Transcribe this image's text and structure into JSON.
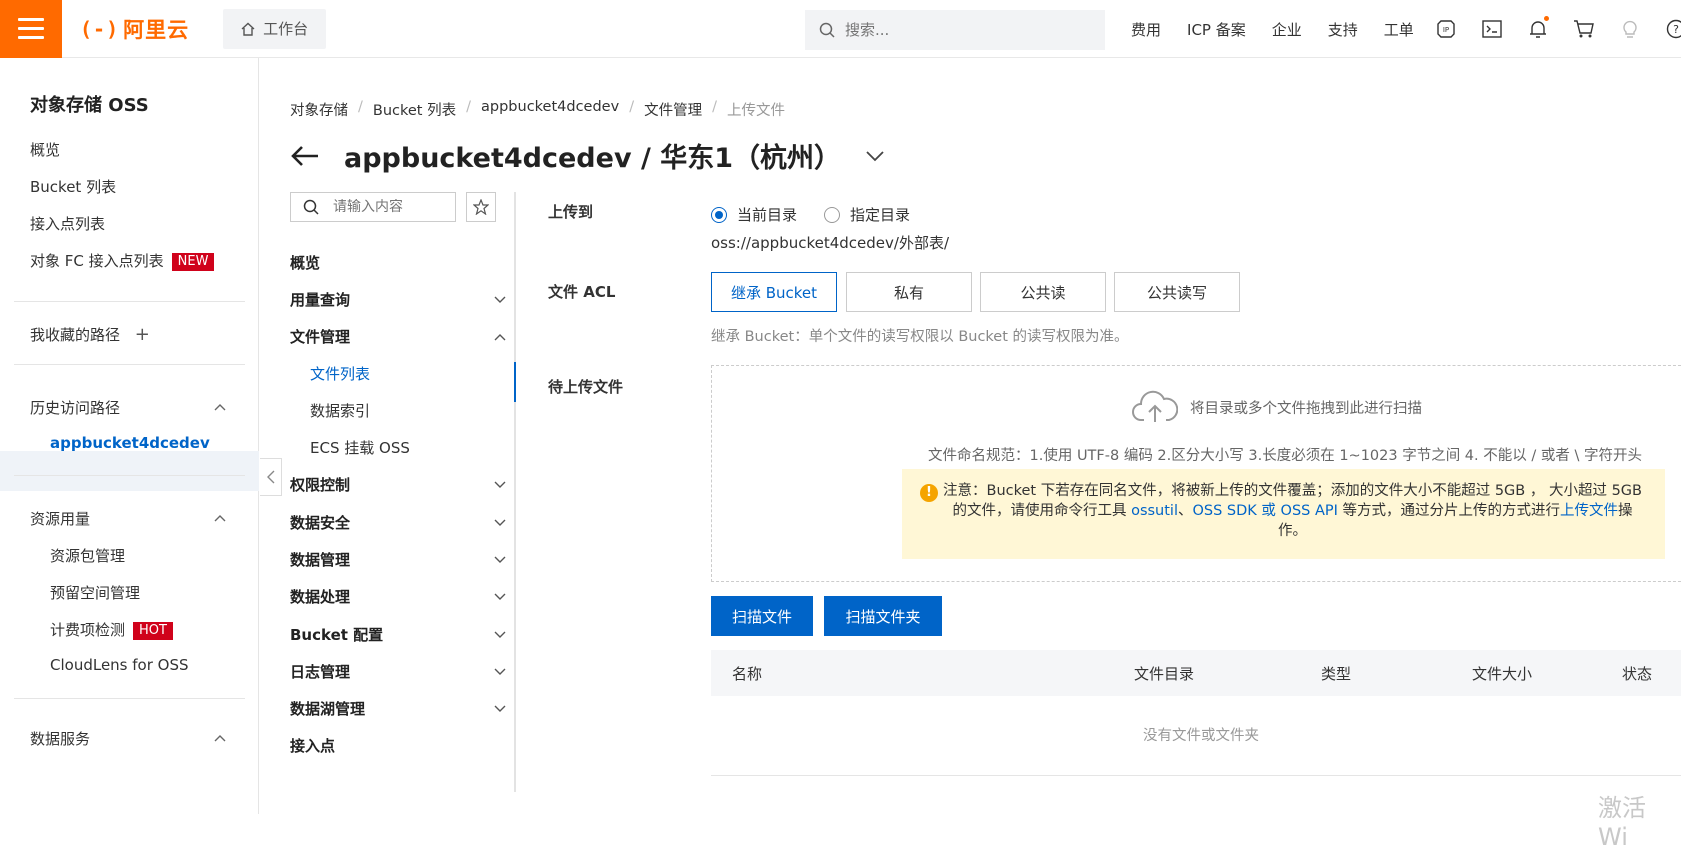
{
  "topbar": {
    "logo_text": "阿里云",
    "logo_mark": "(-)",
    "workbench": "工作台",
    "search_placeholder": "搜索...",
    "nav": [
      "费用",
      "ICP 备案",
      "企业",
      "支持",
      "工单"
    ],
    "icons": [
      "ipv6-icon",
      "terminal-icon",
      "bell-icon",
      "cart-icon",
      "bulb-icon",
      "help-icon"
    ],
    "accent": "#ff6a00"
  },
  "sidebar": {
    "title": "对象存储 OSS",
    "items": {
      "overview": "概览",
      "bucket_list": "Bucket 列表",
      "access_points": "接入点列表",
      "fc_access_points": "对象 FC 接入点列表",
      "new_badge": "NEW",
      "favorites": "我收藏的路径",
      "history": "历史访问路径",
      "history_bucket": "appbucket4dcedev",
      "resource_usage": "资源用量",
      "resource_pkg": "资源包管理",
      "reserved_space": "预留空间管理",
      "billing_check": "计费项检测",
      "hot_badge": "HOT",
      "cloudlens": "CloudLens for OSS",
      "data_services": "数据服务"
    }
  },
  "breadcrumb": [
    "对象存储",
    "Bucket 列表",
    "appbucket4dcedev",
    "文件管理",
    "上传文件"
  ],
  "page_title": "appbucket4dcedev / 华东1（杭州）",
  "subnav": {
    "search_placeholder": "请输入内容",
    "items": {
      "overview": "概览",
      "usage_query": "用量查询",
      "file_mgmt": "文件管理",
      "file_list": "文件列表",
      "data_index": "数据索引",
      "ecs_mount": "ECS 挂载 OSS",
      "permission": "权限控制",
      "data_security": "数据安全",
      "data_mgmt": "数据管理",
      "data_processing": "数据处理",
      "bucket_config": "Bucket 配置",
      "log_mgmt": "日志管理",
      "datalake_mgmt": "数据湖管理",
      "access_point": "接入点"
    }
  },
  "form": {
    "upload_to_label": "上传到",
    "radio_current": "当前目录",
    "radio_specified": "指定目录",
    "selected_radio": "当前目录",
    "path": "oss://appbucket4dcedev/外部表/",
    "acl_label": "文件 ACL",
    "acl_options": [
      "继承 Bucket",
      "私有",
      "公共读",
      "公共读写"
    ],
    "acl_selected": "继承 Bucket",
    "acl_tip": "继承 Bucket：单个文件的读写权限以 Bucket 的读写权限为准。",
    "pending_label": "待上传文件",
    "drop_hint": "将目录或多个文件拖拽到此进行扫描",
    "naming_rule": "文件命名规范：1.使用 UTF-8 编码 2.区分大小写 3.长度必须在 1~1023 字节之间 4. 不能以 / 或者 \\ 字符开头",
    "notice_part1": "注意：Bucket 下若存在同名文件，将被新上传的文件覆盖；添加的文件大小不能超过 5GB ， 大小超过 5GB 的文件，请使用命令行工具 ",
    "notice_link1": "ossutil",
    "notice_sep": "、",
    "notice_link2": "OSS SDK 或 OSS API",
    "notice_part2": " 等方式，通过分片上传的方式进行",
    "notice_link3": "上传文件",
    "notice_part3": "操作。",
    "scan_files": "扫描文件",
    "scan_folder": "扫描文件夹"
  },
  "table": {
    "columns": [
      "名称",
      "文件目录",
      "类型",
      "文件大小",
      "状态"
    ],
    "empty": "没有文件或文件夹"
  },
  "watermark": "激活 Wi"
}
